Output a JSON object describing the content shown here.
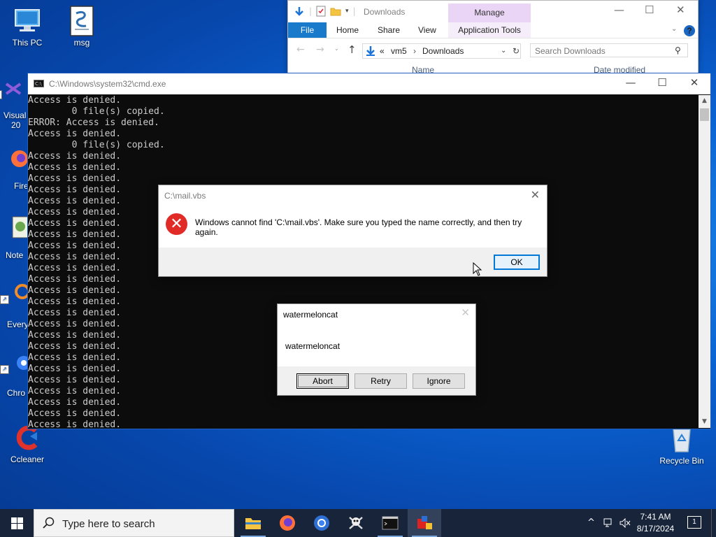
{
  "desktop": {
    "icons": [
      {
        "label": "This PC"
      },
      {
        "label": "msg"
      },
      {
        "label": "Visual"
      },
      {
        "label": "20"
      },
      {
        "label": "Fire"
      },
      {
        "label": "Note"
      },
      {
        "label": "Every"
      },
      {
        "label": "Chro"
      },
      {
        "label": "Ccleaner"
      },
      {
        "label": "Recycle Bin"
      }
    ]
  },
  "explorer": {
    "title": "Downloads",
    "manage_tab": "Manage",
    "ribbon_tabs": [
      "File",
      "Home",
      "Share",
      "View",
      "Application Tools"
    ],
    "breadcrumb": {
      "prefix": "«",
      "parts": [
        "vm5",
        "Downloads"
      ],
      "sep": "›"
    },
    "search_placeholder": "Search Downloads",
    "columns": [
      "Name",
      "Date modified"
    ]
  },
  "cmd": {
    "title": "C:\\Windows\\system32\\cmd.exe",
    "lines": [
      "Access is denied.",
      "        0 file(s) copied.",
      "ERROR: Access is denied.",
      "Access is denied.",
      "        0 file(s) copied.",
      "Access is denied.",
      "Access is denied.",
      "Access is denied.",
      "Access is denied.",
      "Access is denied.",
      "Access is denied.",
      "Access is denied.",
      "Access is denied.",
      "Access is denied.",
      "Access is denied.",
      "Access is denied.",
      "Access is denied.",
      "Access is denied.",
      "Access is denied.",
      "Access is denied.",
      "Access is denied.",
      "Access is denied.",
      "Access is denied.",
      "Access is denied.",
      "Access is denied.",
      "Access is denied.",
      "Access is denied.",
      "Access is denied.",
      "Access is denied.",
      "Access is denied."
    ]
  },
  "error_dialog": {
    "title": "C:\\mail.vbs",
    "message": "Windows cannot find 'C:\\mail.vbs'. Make sure you typed the name correctly, and then try again.",
    "ok_label": "OK"
  },
  "ari_dialog": {
    "title": "watermeloncat",
    "message": "watermeloncat",
    "abort_label": "Abort",
    "retry_label": "Retry",
    "ignore_label": "Ignore"
  },
  "taskbar": {
    "search_placeholder": "Type here to search",
    "time": "7:41 AM",
    "date": "8/17/2024",
    "notification_count": "1"
  },
  "colors": {
    "accent": "#0078d7",
    "error_red": "#e02b27",
    "console_bg": "#0c0c0c",
    "console_text": "#cccccc",
    "taskbar_bg": "#17243a"
  }
}
